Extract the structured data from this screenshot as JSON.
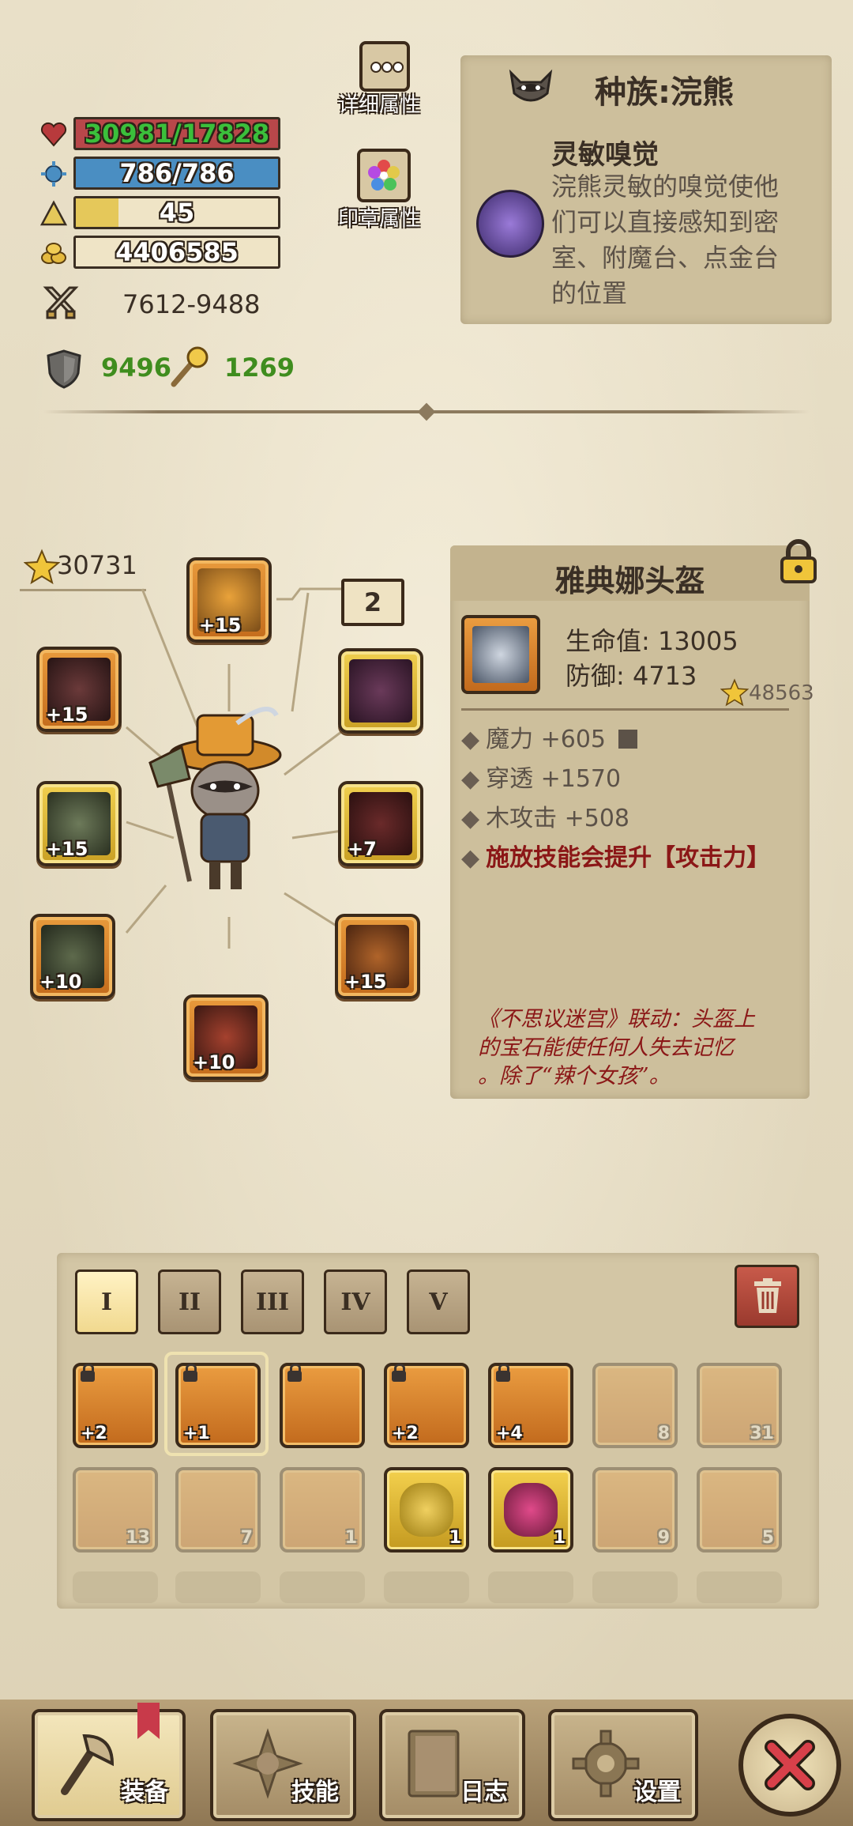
{
  "stats": {
    "hp": "30981/17828",
    "mp": "786/786",
    "level": "45",
    "gold": "4406585",
    "attack": "7612-9488",
    "defense": "9496",
    "magic_resist": "1269"
  },
  "top_buttons": {
    "details": "详细属性",
    "seal": "印章属性"
  },
  "race_panel": {
    "title": "种族:浣熊",
    "skill_name": "灵敏嗅觉",
    "skill_desc_lines": [
      "浣熊灵敏的嗅觉使他",
      "们可以直接感知到密",
      "室、附魔台、点金台",
      "的位置"
    ]
  },
  "equipment": {
    "power_score": "30731",
    "set_number": "2",
    "slots": {
      "helmet": "+15",
      "left_top": "+15",
      "left_mid": "+15",
      "left_bottom": "+10",
      "bottom": "+10",
      "right_mid": "+7",
      "right_bottom": "+15"
    }
  },
  "item_panel": {
    "name": "雅典娜头盔",
    "hp_label": "生命值: 13005",
    "def_label": "防御: 4713",
    "score": "48563",
    "bonuses": [
      "魔力 +605",
      "穿透 +1570",
      "木攻击 +508"
    ],
    "special": "施放技能会提升【攻击力】",
    "lore_lines": [
      "《不思议迷宫》联动：头盔上",
      "的宝石能使任何人失去记忆",
      "。除了“辣个女孩”。"
    ]
  },
  "tabs": [
    "I",
    "II",
    "III",
    "IV",
    "V"
  ],
  "inventory": {
    "row1": [
      "+2",
      "+1",
      "",
      "+2",
      "+4",
      "8",
      "31"
    ],
    "row2": [
      "13",
      "7",
      "1",
      "1",
      "1",
      "9",
      "5"
    ]
  },
  "nav": {
    "equip": "装备",
    "skills": "技能",
    "log": "日志",
    "settings": "设置"
  },
  "colors": {
    "hp": "#b8474a",
    "mp": "#4a8ec2",
    "xp": "#e5c85a",
    "green_text": "#3f8d1e",
    "item_red": "#8b1717"
  }
}
